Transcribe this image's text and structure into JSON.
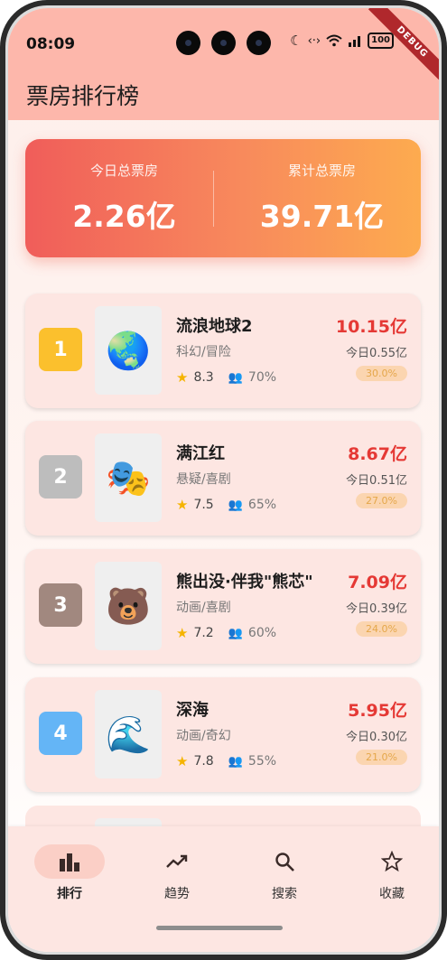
{
  "status_bar": {
    "time": "08:09",
    "battery": "100",
    "debug_label": "DEBUG"
  },
  "header": {
    "title": "票房排行榜"
  },
  "summary": {
    "today_label": "今日总票房",
    "today_value": "2.26亿",
    "total_label": "累计总票房",
    "total_value": "39.71亿"
  },
  "movies": [
    {
      "rank": "1",
      "rank_color": "#fbc02d",
      "poster_icon": "globe-icon",
      "poster_glyph": "🌏",
      "title": "流浪地球2",
      "genre": "科幻/冒险",
      "rating": "8.3",
      "occupancy": "70%",
      "total": "10.15亿",
      "today": "今日0.55亿",
      "share": "30.0%"
    },
    {
      "rank": "2",
      "rank_color": "#bdbdbd",
      "poster_icon": "theater-masks-icon",
      "poster_glyph": "🎭",
      "title": "满江红",
      "genre": "悬疑/喜剧",
      "rating": "7.5",
      "occupancy": "65%",
      "total": "8.67亿",
      "today": "今日0.51亿",
      "share": "27.0%"
    },
    {
      "rank": "3",
      "rank_color": "#a1887f",
      "poster_icon": "bear-icon",
      "poster_glyph": "🐻",
      "title": "熊出没·伴我\"熊芯\"",
      "genre": "动画/喜剧",
      "rating": "7.2",
      "occupancy": "60%",
      "total": "7.09亿",
      "today": "今日0.39亿",
      "share": "24.0%"
    },
    {
      "rank": "4",
      "rank_color": "#64b5f6",
      "poster_icon": "wave-icon",
      "poster_glyph": "🌊",
      "title": "深海",
      "genre": "动画/奇幻",
      "rating": "7.8",
      "occupancy": "55%",
      "total": "5.95亿",
      "today": "今日0.30亿",
      "share": "21.0%"
    }
  ],
  "nav": {
    "items": [
      {
        "label": "排行",
        "icon": "bar-chart-icon",
        "active": true
      },
      {
        "label": "趋势",
        "icon": "trending-up-icon",
        "active": false
      },
      {
        "label": "搜索",
        "icon": "search-icon",
        "active": false
      },
      {
        "label": "收藏",
        "icon": "star-outline-icon",
        "active": false
      }
    ]
  }
}
